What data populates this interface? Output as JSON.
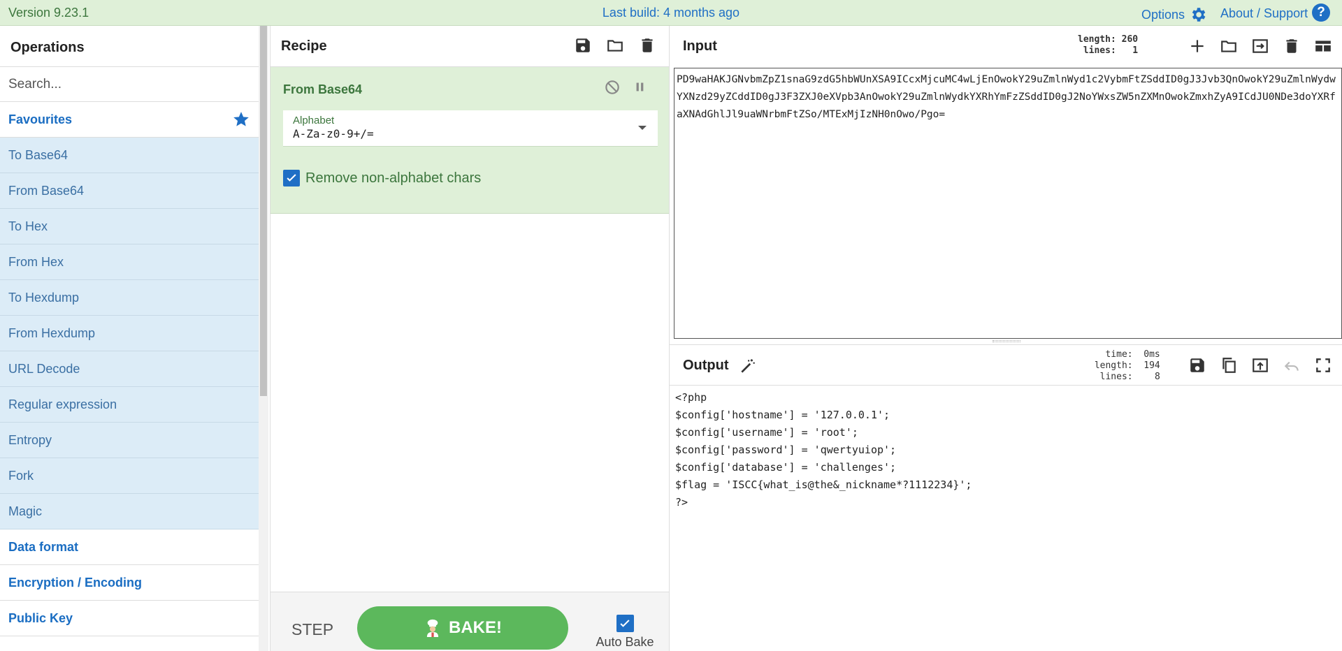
{
  "banner": {
    "version": "Version 9.23.1",
    "last_build": "Last build: 4 months ago",
    "options": "Options",
    "about": "About / Support"
  },
  "operations": {
    "title": "Operations",
    "search_placeholder": "Search...",
    "favourites": "Favourites",
    "favourite_items": [
      "To Base64",
      "From Base64",
      "To Hex",
      "From Hex",
      "To Hexdump",
      "From Hexdump",
      "URL Decode",
      "Regular expression",
      "Entropy",
      "Fork",
      "Magic"
    ],
    "categories": [
      "Data format",
      "Encryption / Encoding",
      "Public Key"
    ]
  },
  "recipe": {
    "title": "Recipe",
    "ingredient_name": "From Base64",
    "alphabet_label": "Alphabet",
    "alphabet_value": "A-Za-z0-9+/=",
    "remove_label": "Remove non-alphabet chars",
    "remove_checked": true,
    "step_label": "STEP",
    "bake_label": "BAKE!",
    "auto_bake_label": "Auto Bake",
    "auto_bake_checked": true
  },
  "input": {
    "title": "Input",
    "length_label": "length:",
    "length_value": "260",
    "lines_label": "lines:",
    "lines_value": "1",
    "text": "PD9waHAKJGNvbmZpZ1snaG9zdG5hbWUnXSA9ICcxMjcuMC4wLjEnOwokY29uZmlnWyd1c2VybmFtZSddID0gJ3Jvb3QnOwokY29uZmlnWydwYXNzd29yZCddID0gJ3F3ZXJ0eXVpb3AnOwokY29uZmlnWydkYXRhYmFzZSddID0gJ2NoYWxsZW5nZXMnOwokZmxhZyA9ICdJU0NDe3doYXRfaXNAdGhlJl9uaWNrbmFtZSo/MTExMjIzNH0nOwo/Pgo="
  },
  "output": {
    "title": "Output",
    "time_label": "time:",
    "time_value": "0ms",
    "length_label": "length:",
    "length_value": "194",
    "lines_label": "lines:",
    "lines_value": "8",
    "lines": [
      "<?php",
      "$config['hostname'] = '127.0.0.1';",
      "$config['username'] = 'root';",
      "$config['password'] = 'qwertyuiop';",
      "$config['database'] = 'challenges';",
      "$flag = 'ISCC{what_is@the&_nickname*?1112234}';",
      "?>"
    ]
  },
  "colors": {
    "banner_bg": "#dff0d8",
    "accent_blue": "#1f6fc5",
    "recipe_green": "#3c763d",
    "bake_green": "#5cb85c",
    "op_bg": "#dcecf7"
  }
}
